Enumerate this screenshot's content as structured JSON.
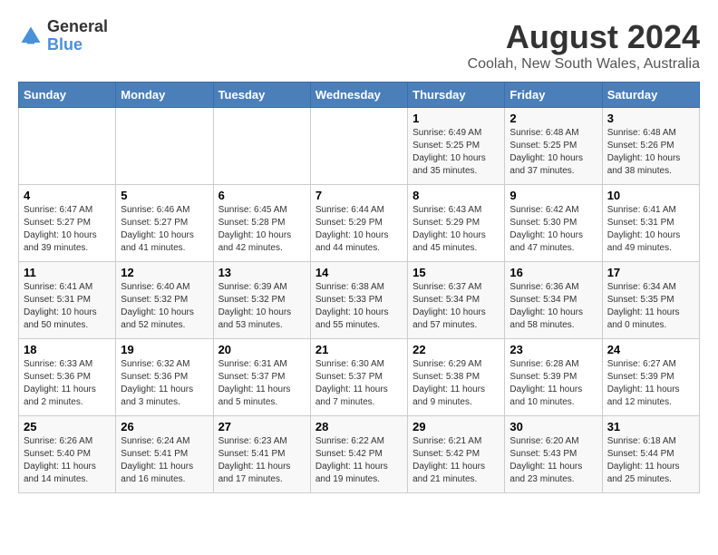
{
  "logo": {
    "line1": "General",
    "line2": "Blue"
  },
  "title": "August 2024",
  "subtitle": "Coolah, New South Wales, Australia",
  "days_of_week": [
    "Sunday",
    "Monday",
    "Tuesday",
    "Wednesday",
    "Thursday",
    "Friday",
    "Saturday"
  ],
  "weeks": [
    [
      {
        "day": "",
        "sunrise": "",
        "sunset": "",
        "daylight": ""
      },
      {
        "day": "",
        "sunrise": "",
        "sunset": "",
        "daylight": ""
      },
      {
        "day": "",
        "sunrise": "",
        "sunset": "",
        "daylight": ""
      },
      {
        "day": "",
        "sunrise": "",
        "sunset": "",
        "daylight": ""
      },
      {
        "day": "1",
        "sunrise": "6:49 AM",
        "sunset": "5:25 PM",
        "daylight": "10 hours and 35 minutes."
      },
      {
        "day": "2",
        "sunrise": "6:48 AM",
        "sunset": "5:25 PM",
        "daylight": "10 hours and 37 minutes."
      },
      {
        "day": "3",
        "sunrise": "6:48 AM",
        "sunset": "5:26 PM",
        "daylight": "10 hours and 38 minutes."
      }
    ],
    [
      {
        "day": "4",
        "sunrise": "6:47 AM",
        "sunset": "5:27 PM",
        "daylight": "10 hours and 39 minutes."
      },
      {
        "day": "5",
        "sunrise": "6:46 AM",
        "sunset": "5:27 PM",
        "daylight": "10 hours and 41 minutes."
      },
      {
        "day": "6",
        "sunrise": "6:45 AM",
        "sunset": "5:28 PM",
        "daylight": "10 hours and 42 minutes."
      },
      {
        "day": "7",
        "sunrise": "6:44 AM",
        "sunset": "5:29 PM",
        "daylight": "10 hours and 44 minutes."
      },
      {
        "day": "8",
        "sunrise": "6:43 AM",
        "sunset": "5:29 PM",
        "daylight": "10 hours and 45 minutes."
      },
      {
        "day": "9",
        "sunrise": "6:42 AM",
        "sunset": "5:30 PM",
        "daylight": "10 hours and 47 minutes."
      },
      {
        "day": "10",
        "sunrise": "6:41 AM",
        "sunset": "5:31 PM",
        "daylight": "10 hours and 49 minutes."
      }
    ],
    [
      {
        "day": "11",
        "sunrise": "6:41 AM",
        "sunset": "5:31 PM",
        "daylight": "10 hours and 50 minutes."
      },
      {
        "day": "12",
        "sunrise": "6:40 AM",
        "sunset": "5:32 PM",
        "daylight": "10 hours and 52 minutes."
      },
      {
        "day": "13",
        "sunrise": "6:39 AM",
        "sunset": "5:32 PM",
        "daylight": "10 hours and 53 minutes."
      },
      {
        "day": "14",
        "sunrise": "6:38 AM",
        "sunset": "5:33 PM",
        "daylight": "10 hours and 55 minutes."
      },
      {
        "day": "15",
        "sunrise": "6:37 AM",
        "sunset": "5:34 PM",
        "daylight": "10 hours and 57 minutes."
      },
      {
        "day": "16",
        "sunrise": "6:36 AM",
        "sunset": "5:34 PM",
        "daylight": "10 hours and 58 minutes."
      },
      {
        "day": "17",
        "sunrise": "6:34 AM",
        "sunset": "5:35 PM",
        "daylight": "11 hours and 0 minutes."
      }
    ],
    [
      {
        "day": "18",
        "sunrise": "6:33 AM",
        "sunset": "5:36 PM",
        "daylight": "11 hours and 2 minutes."
      },
      {
        "day": "19",
        "sunrise": "6:32 AM",
        "sunset": "5:36 PM",
        "daylight": "11 hours and 3 minutes."
      },
      {
        "day": "20",
        "sunrise": "6:31 AM",
        "sunset": "5:37 PM",
        "daylight": "11 hours and 5 minutes."
      },
      {
        "day": "21",
        "sunrise": "6:30 AM",
        "sunset": "5:37 PM",
        "daylight": "11 hours and 7 minutes."
      },
      {
        "day": "22",
        "sunrise": "6:29 AM",
        "sunset": "5:38 PM",
        "daylight": "11 hours and 9 minutes."
      },
      {
        "day": "23",
        "sunrise": "6:28 AM",
        "sunset": "5:39 PM",
        "daylight": "11 hours and 10 minutes."
      },
      {
        "day": "24",
        "sunrise": "6:27 AM",
        "sunset": "5:39 PM",
        "daylight": "11 hours and 12 minutes."
      }
    ],
    [
      {
        "day": "25",
        "sunrise": "6:26 AM",
        "sunset": "5:40 PM",
        "daylight": "11 hours and 14 minutes."
      },
      {
        "day": "26",
        "sunrise": "6:24 AM",
        "sunset": "5:41 PM",
        "daylight": "11 hours and 16 minutes."
      },
      {
        "day": "27",
        "sunrise": "6:23 AM",
        "sunset": "5:41 PM",
        "daylight": "11 hours and 17 minutes."
      },
      {
        "day": "28",
        "sunrise": "6:22 AM",
        "sunset": "5:42 PM",
        "daylight": "11 hours and 19 minutes."
      },
      {
        "day": "29",
        "sunrise": "6:21 AM",
        "sunset": "5:42 PM",
        "daylight": "11 hours and 21 minutes."
      },
      {
        "day": "30",
        "sunrise": "6:20 AM",
        "sunset": "5:43 PM",
        "daylight": "11 hours and 23 minutes."
      },
      {
        "day": "31",
        "sunrise": "6:18 AM",
        "sunset": "5:44 PM",
        "daylight": "11 hours and 25 minutes."
      }
    ]
  ]
}
